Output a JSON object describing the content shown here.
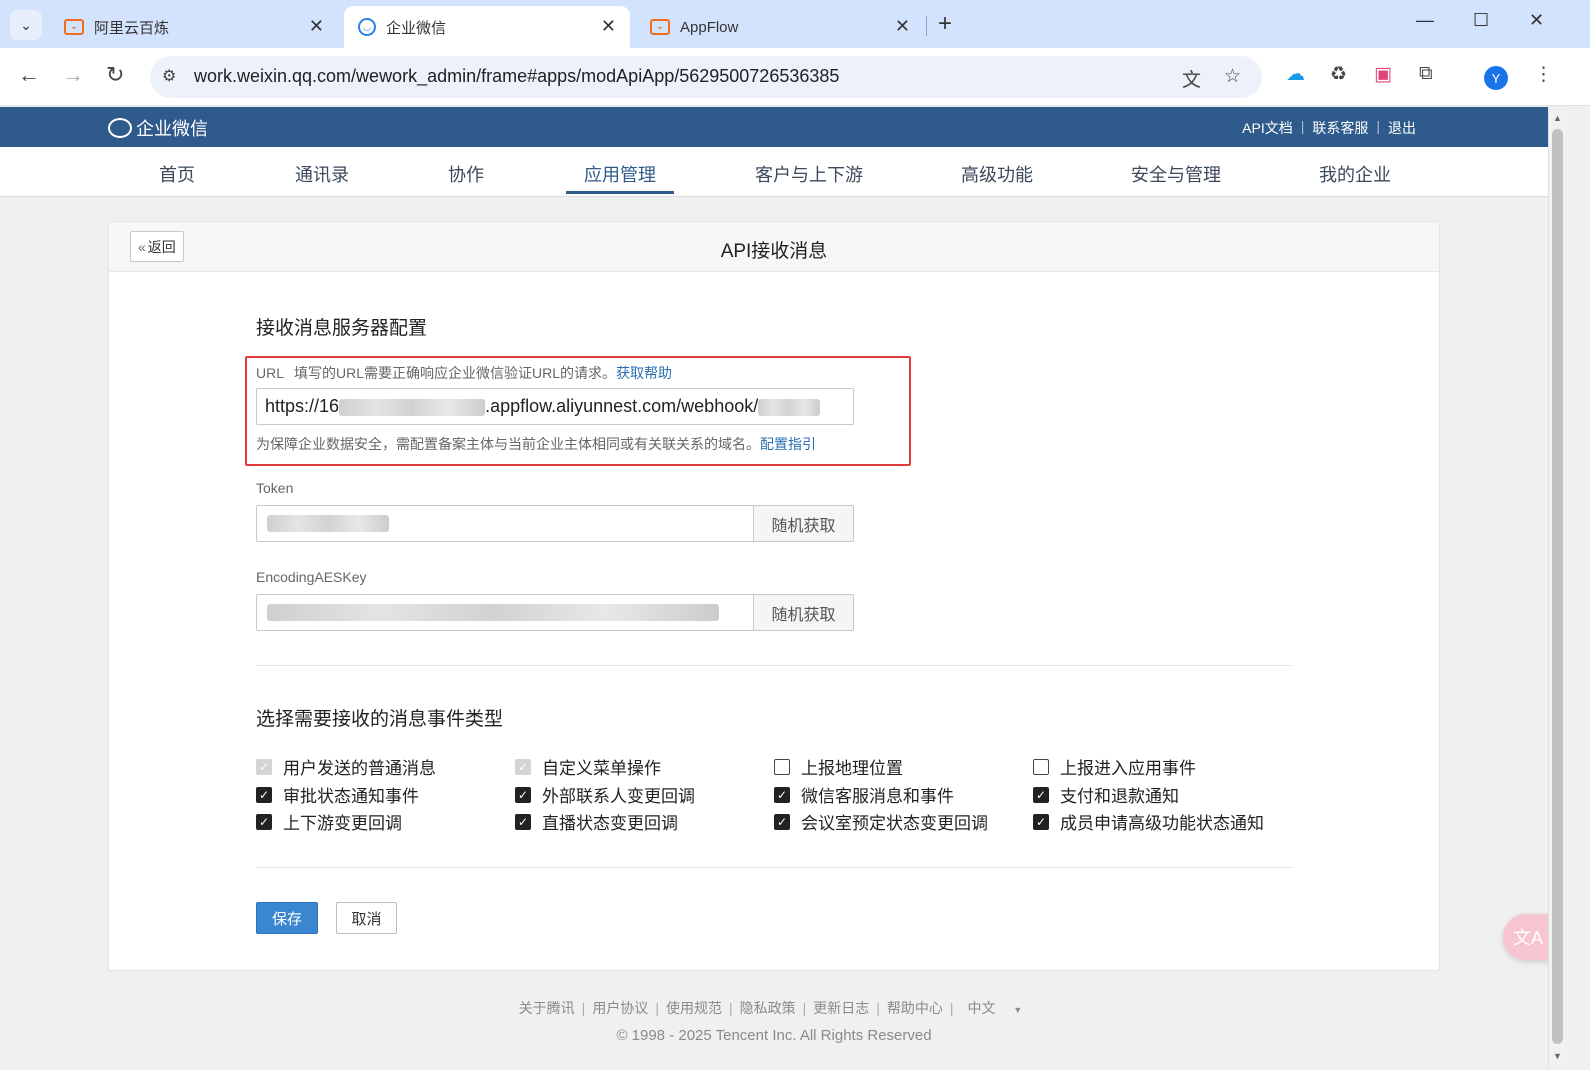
{
  "browser": {
    "tabs": [
      {
        "title": "阿里云百炼",
        "favicon": "aliyun-icon",
        "active": false
      },
      {
        "title": "企业微信",
        "favicon": "wework-icon",
        "active": true
      },
      {
        "title": "AppFlow",
        "favicon": "aliyun-icon",
        "active": false
      }
    ],
    "url": "work.weixin.qq.com/wework_admin/frame#apps/modApiApp/5629500726536385",
    "profile_initial": "Y"
  },
  "header": {
    "brand": "企业微信",
    "links": [
      "API文档",
      "联系客服",
      "退出"
    ]
  },
  "nav": {
    "items": [
      "首页",
      "通讯录",
      "协作",
      "应用管理",
      "客户与上下游",
      "高级功能",
      "安全与管理",
      "我的企业"
    ],
    "active": "应用管理"
  },
  "page": {
    "back_label": "返回",
    "title": "API接收消息"
  },
  "server_config": {
    "title": "接收消息服务器配置",
    "url_label": "URL",
    "url_hint": "填写的URL需要正确响应企业微信验证URL的请求。",
    "url_help_link": "获取帮助",
    "url_value_prefix": "https://16",
    "url_value_middle": ".appflow.aliyunnest.com/webhook/",
    "url_note": "为保障企业数据安全，需配置备案主体与当前企业主体相同或有关联关系的域名。",
    "url_note_link": "配置指引",
    "token_label": "Token",
    "aeskey_label": "EncodingAESKey",
    "random_button": "随机获取"
  },
  "events": {
    "title": "选择需要接收的消息事件类型",
    "items": [
      {
        "label": "用户发送的普通消息",
        "state": "checked-disabled"
      },
      {
        "label": "自定义菜单操作",
        "state": "checked-disabled"
      },
      {
        "label": "上报地理位置",
        "state": "unchecked"
      },
      {
        "label": "上报进入应用事件",
        "state": "unchecked"
      },
      {
        "label": "审批状态通知事件",
        "state": "checked"
      },
      {
        "label": "外部联系人变更回调",
        "state": "checked"
      },
      {
        "label": "微信客服消息和事件",
        "state": "checked"
      },
      {
        "label": "支付和退款通知",
        "state": "checked"
      },
      {
        "label": "上下游变更回调",
        "state": "checked"
      },
      {
        "label": "直播状态变更回调",
        "state": "checked"
      },
      {
        "label": "会议室预定状态变更回调",
        "state": "checked"
      },
      {
        "label": "成员申请高级功能状态通知",
        "state": "checked"
      }
    ]
  },
  "actions": {
    "save": "保存",
    "cancel": "取消"
  },
  "footer": {
    "links": [
      "关于腾讯",
      "用户协议",
      "使用规范",
      "隐私政策",
      "更新日志",
      "帮助中心"
    ],
    "language": "中文",
    "copyright": "© 1998 - 2025 Tencent Inc. All Rights Reserved"
  },
  "colors": {
    "header_bg": "#2f5b8c",
    "primary_button": "#3b86d0",
    "highlight_box": "#e23b3b",
    "link": "#2a6fb5"
  }
}
